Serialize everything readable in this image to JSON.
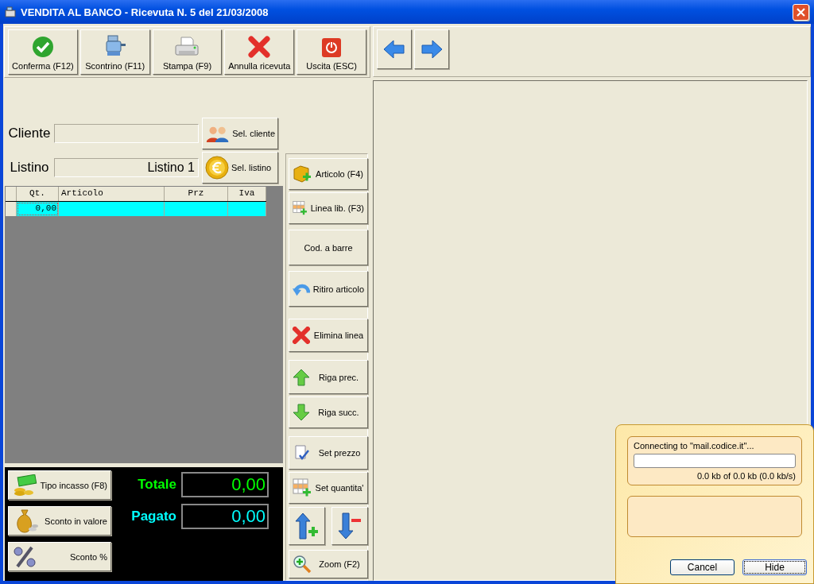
{
  "window": {
    "title": "VENDITA AL BANCO - Ricevuta N. 5 del 21/03/2008"
  },
  "toolbar": [
    {
      "label": "Conferma (F12)"
    },
    {
      "label": "Scontrino (F11)"
    },
    {
      "label": "Stampa (F9)"
    },
    {
      "label": "Annulla ricevuta"
    },
    {
      "label": "Uscita (ESC)"
    }
  ],
  "cliente": {
    "label": "Cliente",
    "button": "Sel. cliente"
  },
  "listino": {
    "label": "Listino",
    "value": "Listino 1",
    "button": "Sel. listino"
  },
  "grid": {
    "columns": [
      "Qt.",
      "Articolo",
      "Prz",
      "Iva"
    ],
    "rows": [
      {
        "qt": "0,00",
        "selected": true
      }
    ]
  },
  "side_buttons": [
    {
      "label": "Articolo (F4)"
    },
    {
      "label": "Linea lib. (F3)"
    },
    {
      "label": "Cod. a barre"
    },
    {
      "label": "Ritiro articolo"
    },
    {
      "label": "Elimina linea"
    },
    {
      "label": "Riga prec."
    },
    {
      "label": "Riga succ."
    },
    {
      "label": "Set prezzo"
    },
    {
      "label": "Set quantita'"
    }
  ],
  "zoom_button": {
    "label": "Zoom (F2)"
  },
  "payment_buttons": [
    {
      "label": "Tipo incasso (F8)"
    },
    {
      "label": "Sconto in valore"
    },
    {
      "label": "Sconto %"
    }
  ],
  "totals": [
    {
      "label": "Totale",
      "value": "0,00",
      "color": "#00ff00"
    },
    {
      "label": "Pagato",
      "value": "0,00",
      "color": "#00ffff"
    }
  ],
  "popup": {
    "status": "Connecting to \"mail.codice.it\"...",
    "level": 0,
    "transfer": "0.0 kb of 0.0 kb (0.0 kb/s)",
    "buttons": [
      {
        "label": "Cancel",
        "focused": false
      },
      {
        "label": "Hide",
        "focused": true
      }
    ]
  }
}
